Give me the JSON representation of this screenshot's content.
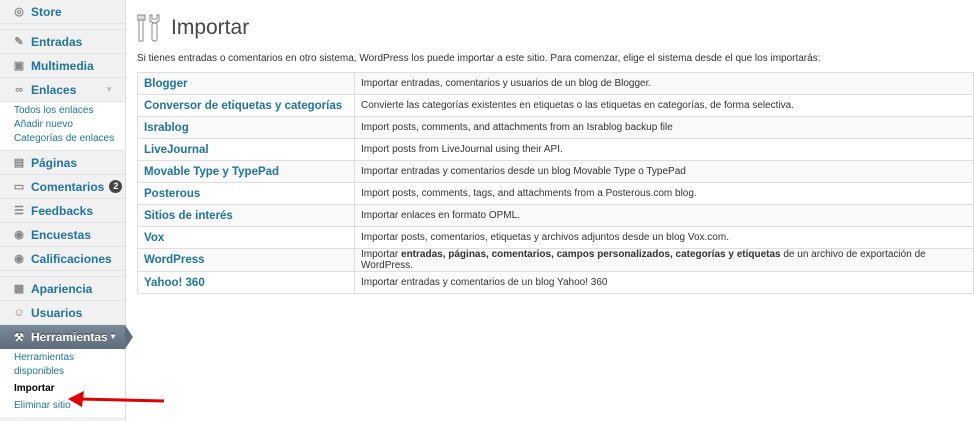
{
  "sidebar": {
    "store": "Store",
    "entradas": "Entradas",
    "multimedia": "Multimedia",
    "enlaces": "Enlaces",
    "enlaces_sub": [
      "Todos los enlaces",
      "Añadir nuevo",
      "Categorías de enlaces"
    ],
    "paginas": "Páginas",
    "comentarios": "Comentarios",
    "comentarios_count": "2",
    "feedbacks": "Feedbacks",
    "encuestas": "Encuestas",
    "calificaciones": "Calificaciones",
    "apariencia": "Apariencia",
    "usuarios": "Usuarios",
    "herramientas": "Herramientas",
    "herramientas_sub": [
      "Herramientas disponibles",
      "Importar",
      "Eliminar sitio"
    ]
  },
  "main": {
    "title": "Importar",
    "intro": "Si tienes entradas o comentarios en otro sistema, WordPress los puede importar a este sitio. Para comenzar, elige el sistema desde el que los importarás:",
    "importers": [
      {
        "name": "Blogger",
        "desc": "Importar entradas, comentarios y usuarios de un blog de Blogger."
      },
      {
        "name": "Conversor de etiquetas y categorías",
        "desc": "Convierte las categorías existentes en etiquetas o las etiquetas en categorías, de forma selectiva."
      },
      {
        "name": "Israblog",
        "desc": "Import posts, comments, and attachments from an Israblog backup file"
      },
      {
        "name": "LiveJournal",
        "desc": "Import posts from LiveJournal using their API."
      },
      {
        "name": "Movable Type y TypePad",
        "desc": "Importar entradas y comentarios desde un blog Movable Type o TypePad"
      },
      {
        "name": "Posterous",
        "desc": "Import posts, comments, tags, and attachments from a Posterous.com blog."
      },
      {
        "name": "Sitios de interés",
        "desc": "Importar enlaces en formato OPML."
      },
      {
        "name": "Vox",
        "desc": "Importar posts, comentarios, etiquetas y archivos adjuntos desde un blog Vox.com."
      },
      {
        "name": "WordPress",
        "desc_pre": "Importar ",
        "desc_bold": "entradas, páginas, comentarios, campos personalizados, categorías y etiquetas",
        "desc_post": " de un archivo de exportación de WordPress."
      },
      {
        "name": "Yahoo! 360",
        "desc": "Importar entradas y comentarios de un blog Yahoo! 360"
      }
    ]
  },
  "colors": {
    "link": "#21759b",
    "active_menu": "#5d6d7c",
    "annotation_arrow": "#e00000"
  }
}
